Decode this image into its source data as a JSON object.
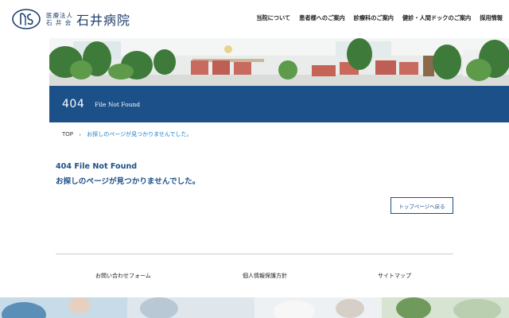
{
  "header": {
    "logo_corp_line1": "医療法人",
    "logo_corp_line2": "石 井 会",
    "logo_name": "石井病院",
    "nav": [
      {
        "label": "当院について"
      },
      {
        "label": "患者様へのご案内"
      },
      {
        "label": "診療科のご案内"
      },
      {
        "label": "健診・人間ドックのご案内"
      },
      {
        "label": "採用情報"
      }
    ]
  },
  "title_band": {
    "code": "404",
    "subtitle": "File Not Found",
    "color": "#1b5089"
  },
  "breadcrumb": {
    "home": "TOP",
    "separator": "›",
    "current": "お探しのページが見つかりませんでした。"
  },
  "content": {
    "heading_line1": "404 File Not Found",
    "heading_line2": "お探しのページが見つかりませんでした。",
    "back_button": "トップページへ戻る"
  },
  "footer": {
    "links": [
      {
        "label": "お問い合わせフォーム"
      },
      {
        "label": "個人情報保護方針"
      },
      {
        "label": "サイトマップ"
      }
    ]
  }
}
